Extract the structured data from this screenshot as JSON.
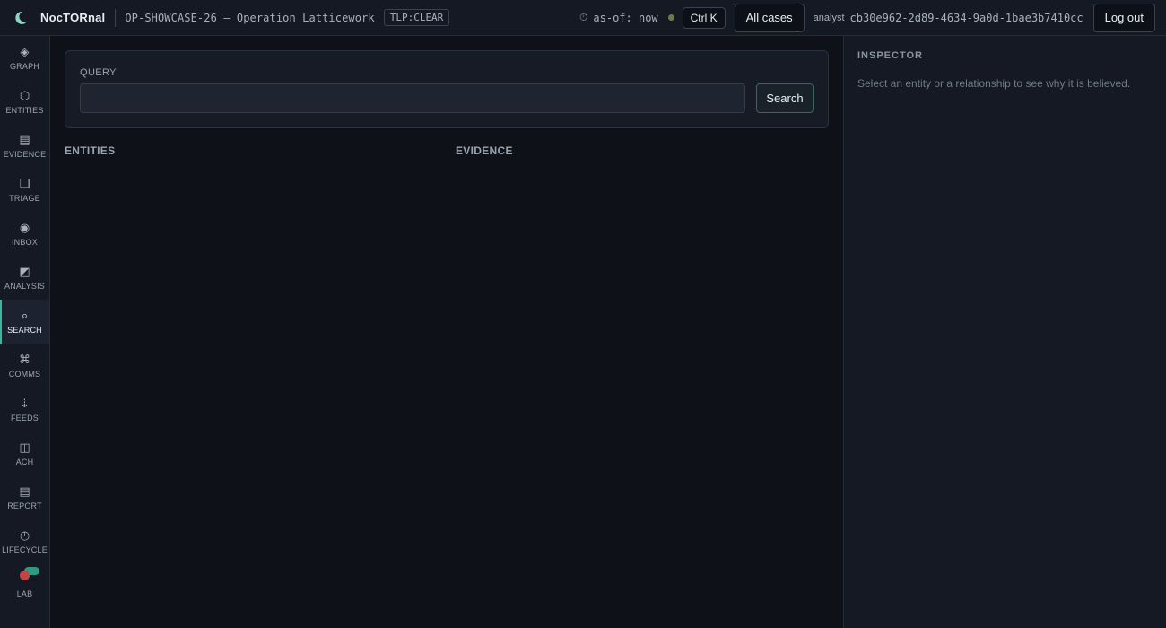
{
  "app": {
    "name": "NocTORnal",
    "case_id": "OP-SHOWCASE-26 — Operation Latticework",
    "tlp": "TLP:CLEAR"
  },
  "header": {
    "asof_label": "as-of: now",
    "status_color": "#6f7b3c",
    "shortcut_label": "Ctrl K",
    "all_cases_label": "All cases",
    "user_role": "analyst",
    "user_id": "cb30e962-2d89-4634-9a0d-1bae3b7410cc",
    "logout_label": "Log out"
  },
  "nav": {
    "items": [
      {
        "label": "GRAPH",
        "icon": "◈"
      },
      {
        "label": "ENTITIES",
        "icon": "⬡"
      },
      {
        "label": "EVIDENCE",
        "icon": "▤"
      },
      {
        "label": "TRIAGE",
        "icon": "❏"
      },
      {
        "label": "INBOX",
        "icon": "◉"
      },
      {
        "label": "ANALYSIS",
        "icon": "◩"
      },
      {
        "label": "SEARCH",
        "icon": "⌕"
      },
      {
        "label": "COMMS",
        "icon": "⌘"
      },
      {
        "label": "FEEDS",
        "icon": "⇣"
      },
      {
        "label": "ACH",
        "icon": "◫"
      },
      {
        "label": "REPORT",
        "icon": "▤"
      },
      {
        "label": "LIFECYCLE",
        "icon": "◴"
      },
      {
        "label": "LAB",
        "icon": ""
      }
    ],
    "active": "SEARCH",
    "accent_color": "#3fb59a"
  },
  "main": {
    "query_label": "QUERY",
    "query_value": "",
    "search_button": "Search",
    "entities_heading": "ENTITIES",
    "evidence_heading": "EVIDENCE"
  },
  "inspector": {
    "title": "INSPECTOR",
    "hint": "Select an entity or a relationship to see why it is believed."
  }
}
